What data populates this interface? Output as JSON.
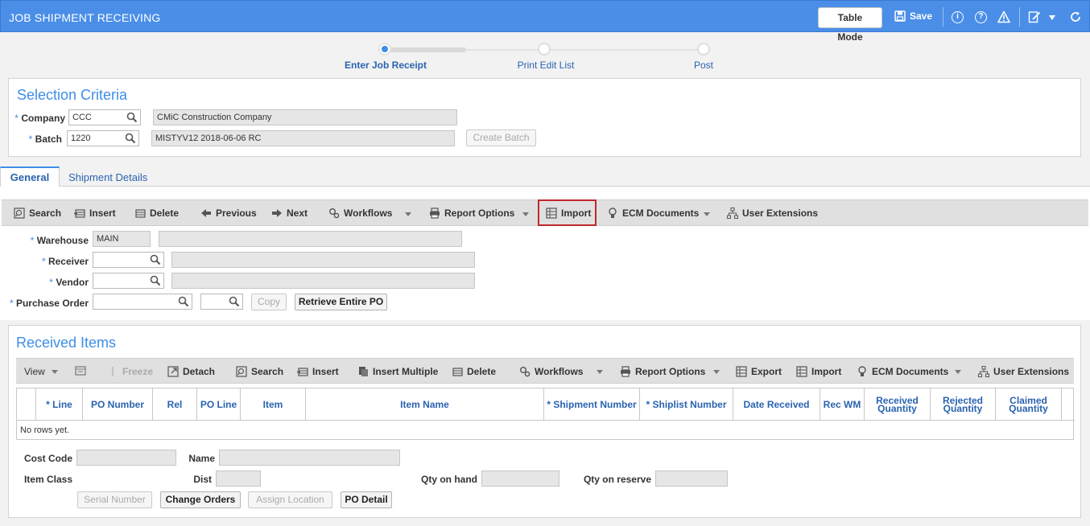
{
  "app": {
    "title": "JOB SHIPMENT RECEIVING",
    "table_mode": "Table Mode",
    "save": "Save"
  },
  "colors": {
    "header": "#4a8ee8",
    "accent": "#3d8ee6",
    "link": "#2a63b0",
    "highlight": "#c0282d"
  },
  "progress": {
    "steps": [
      {
        "label": "Enter Job Receipt",
        "state": "active"
      },
      {
        "label": "Print Edit List",
        "state": "pending"
      },
      {
        "label": "Post",
        "state": "pending"
      }
    ]
  },
  "selection": {
    "title": "Selection Criteria",
    "company_label": "Company",
    "company_code": "CCC",
    "company_name": "CMiC Construction Company",
    "batch_label": "Batch",
    "batch_code": "1220",
    "batch_name": "MISTYV12 2018-06-06 RC",
    "create_batch": "Create Batch",
    "required_mark": "*"
  },
  "tabs": [
    {
      "label": "General",
      "active": true
    },
    {
      "label": "Shipment Details",
      "active": false
    }
  ],
  "toolbar": {
    "search": "Search",
    "insert": "Insert",
    "delete": "Delete",
    "previous": "Previous",
    "next": "Next",
    "workflows": "Workflows",
    "report_options": "Report Options",
    "import": "Import",
    "ecm_documents": "ECM Documents",
    "user_extensions": "User Extensions"
  },
  "general": {
    "warehouse_label": "Warehouse",
    "warehouse_value": "MAIN",
    "receiver_label": "Receiver",
    "receiver_value": "",
    "vendor_label": "Vendor",
    "vendor_value": "",
    "po_label": "Purchase Order",
    "po_value": "",
    "po_rel_value": "",
    "copy": "Copy",
    "retrieve_po": "Retrieve Entire PO"
  },
  "received": {
    "title": "Received Items",
    "toolbar": {
      "view": "View",
      "freeze": "Freeze",
      "detach": "Detach",
      "search": "Search",
      "insert": "Insert",
      "insert_multiple": "Insert Multiple",
      "delete": "Delete",
      "workflows": "Workflows",
      "report_options": "Report Options",
      "export": "Export",
      "import": "Import",
      "ecm_documents": "ECM Documents",
      "user_extensions": "User Extensions"
    },
    "columns": [
      {
        "label": "* Line"
      },
      {
        "label": "PO Number"
      },
      {
        "label": "Rel"
      },
      {
        "label": "PO Line"
      },
      {
        "label": "Item"
      },
      {
        "label": "Item Name"
      },
      {
        "label": "* Shipment Number"
      },
      {
        "label": "* Shiplist Number"
      },
      {
        "label": "Date Received"
      },
      {
        "label": "Rec WM"
      },
      {
        "label": "Received Quantity"
      },
      {
        "label": "Rejected Quantity"
      },
      {
        "label": "Claimed Quantity"
      }
    ],
    "empty_text": "No rows yet."
  },
  "detail": {
    "cost_code_label": "Cost Code",
    "name_label": "Name",
    "item_class_label": "Item Class",
    "dist_label": "Dist",
    "qty_on_hand_label": "Qty on hand",
    "qty_on_reserve_label": "Qty on reserve",
    "serial_number": "Serial Number",
    "change_orders": "Change Orders",
    "assign_location": "Assign Location",
    "po_detail": "PO Detail"
  }
}
